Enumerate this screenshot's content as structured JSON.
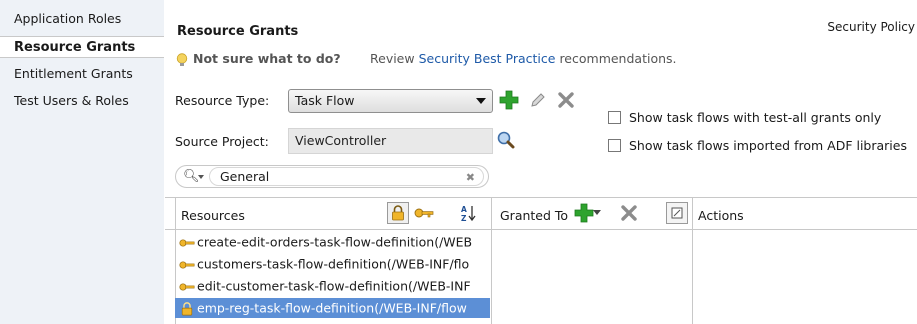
{
  "sidebar": {
    "items": [
      {
        "label": "Application Roles",
        "active": false
      },
      {
        "label": "Resource Grants",
        "active": true
      },
      {
        "label": "Entitlement Grants",
        "active": false
      },
      {
        "label": "Test Users & Roles",
        "active": false
      }
    ]
  },
  "header": {
    "title": "Resource Grants",
    "security_policy": "Security Policy"
  },
  "tip": {
    "question": "Not sure what to do?",
    "prefix": " Review ",
    "link": "Security Best Practice",
    "suffix": " recommendations."
  },
  "form": {
    "resource_type_label": "Resource Type:",
    "resource_type_value": "Task Flow",
    "source_project_label": "Source Project:",
    "source_project_value": "ViewController",
    "option_test_all": "Show task flows with test-all grants only",
    "option_imported": "Show task flows imported from ADF libraries"
  },
  "search": {
    "value": "General"
  },
  "table": {
    "resources_header": "Resources",
    "granted_to_header": "Granted To",
    "actions_header": "Actions",
    "rows": [
      {
        "label": "create-edit-orders-task-flow-definition(/WEB",
        "icon": "key-icon",
        "selected": false
      },
      {
        "label": "customers-task-flow-definition(/WEB-INF/flo",
        "icon": "key-icon",
        "selected": false
      },
      {
        "label": "edit-customer-task-flow-definition(/WEB-INF",
        "icon": "key-icon",
        "selected": false
      },
      {
        "label": "emp-reg-task-flow-definition(/WEB-INF/flow",
        "icon": "lock-icon",
        "selected": true
      }
    ]
  },
  "colors": {
    "selection": "#5c8fd6",
    "link": "#1e5aa8",
    "add_green": "#2ea32e",
    "key_gold": "#e0a81e"
  }
}
